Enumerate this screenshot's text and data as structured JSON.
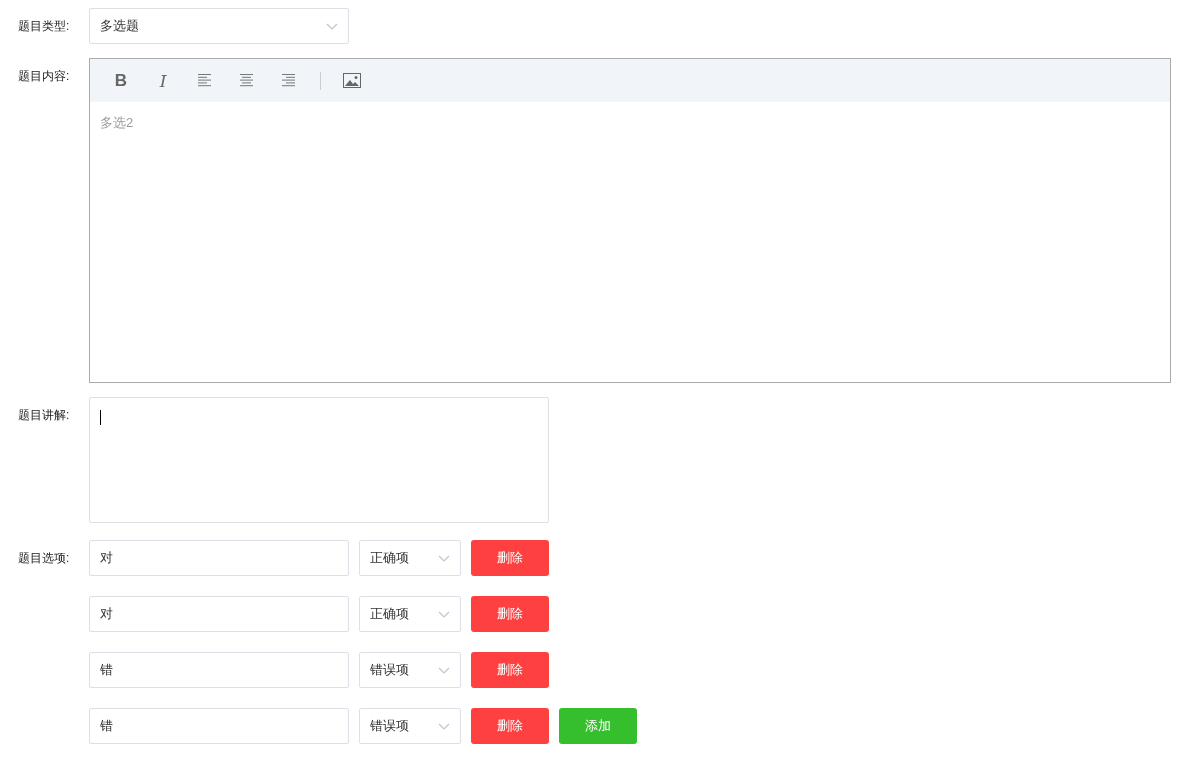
{
  "question_type": {
    "label": "题目类型:",
    "value": "多选题"
  },
  "content": {
    "label": "题目内容:",
    "toolbar": [
      {
        "kind": "bold",
        "label": "B"
      },
      {
        "kind": "italic",
        "label": "I"
      },
      {
        "kind": "align-left"
      },
      {
        "kind": "align-center"
      },
      {
        "kind": "align-right"
      },
      {
        "kind": "divider"
      },
      {
        "kind": "image"
      }
    ],
    "placeholder": "多选2"
  },
  "explanation": {
    "label": "题目讲解:",
    "focused": true
  },
  "options": {
    "label": "题目选项:",
    "rows": [
      {
        "text": "对",
        "answer": "正确项",
        "delete": "删除"
      },
      {
        "text": "对",
        "answer": "正确项",
        "delete": "删除"
      },
      {
        "text": "错",
        "answer": "错误项",
        "delete": "删除"
      },
      {
        "text": "错",
        "answer": "错误项",
        "delete": "删除"
      }
    ],
    "add_button": "添加"
  }
}
